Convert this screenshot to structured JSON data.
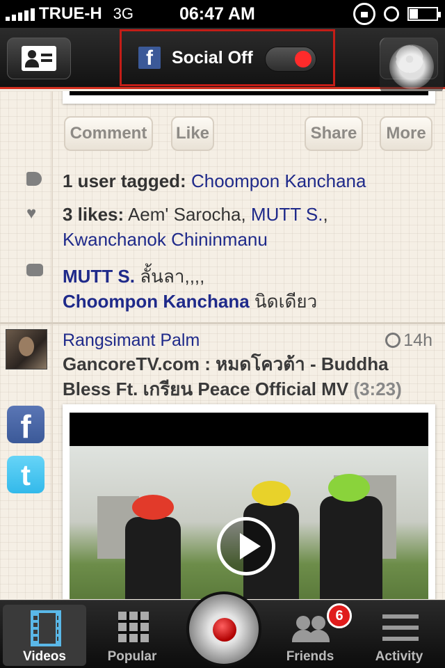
{
  "status_bar": {
    "carrier": "TRUE-H",
    "network": "3G",
    "time": "06:47 AM"
  },
  "nav_bar": {
    "social_toggle_label": "Social Off",
    "social_enabled": false,
    "accent_color": "#d63020"
  },
  "post1": {
    "actions": [
      "Comment",
      "Like",
      "Share",
      "More"
    ],
    "tagged_count_label": "1 user tagged:",
    "tagged_user": "Choompon Kanchana",
    "likes_label": "3 likes:",
    "liker1": "Aem' Sarocha,",
    "liker2": "MUTT S.",
    "liker2_suffix": ",",
    "liker3": "Kwanchanok Chininmanu",
    "comments": [
      {
        "author": "MUTT S.",
        "text": "ลั้นลา,,,,"
      },
      {
        "author": "Choompon Kanchana",
        "text": "นิดเดียว"
      }
    ]
  },
  "post2": {
    "poster": "Rangsimant Palm",
    "time_ago": "14h",
    "title_part1": "GancoreTV.com : หมดโควต้า - Buddha Bless Ft. เกรียน Peace Official MV",
    "duration": "(3:23)"
  },
  "share_icons": {
    "facebook": "f",
    "twitter": "t"
  },
  "tab_bar": {
    "tabs": [
      {
        "label": "Videos",
        "icon": "film-icon",
        "active": true
      },
      {
        "label": "Popular",
        "icon": "grid-icon",
        "active": false
      },
      {
        "label": "Friends",
        "icon": "friends-icon",
        "active": false
      },
      {
        "label": "Activity",
        "icon": "list-icon",
        "active": false
      }
    ],
    "friends_badge": "6"
  }
}
